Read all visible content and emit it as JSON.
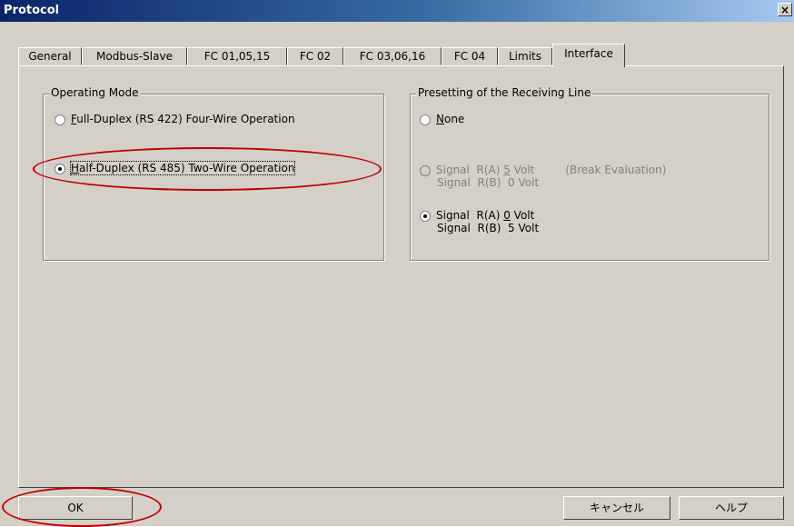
{
  "window": {
    "title": "Protocol",
    "close_glyph": "×"
  },
  "tabs": [
    {
      "label": "General"
    },
    {
      "label": "Modbus-Slave"
    },
    {
      "label": "FC 01,05,15"
    },
    {
      "label": "FC 02"
    },
    {
      "label": "FC 03,06,16"
    },
    {
      "label": "FC 04"
    },
    {
      "label": "Limits"
    },
    {
      "label": "Interface"
    }
  ],
  "active_tab": "Interface",
  "operating_mode": {
    "title": "Operating Mode",
    "full_duplex": {
      "mnemonic": "F",
      "rest": "ull-Duplex (RS 422) Four-Wire Operation",
      "selected": false
    },
    "half_duplex": {
      "mnemonic": "H",
      "rest": "alf-Duplex (RS 485) Two-Wire Operation",
      "selected": true
    }
  },
  "presetting": {
    "title": "Presetting of the Receiving Line",
    "none": {
      "mnemonic": "N",
      "rest": "one",
      "selected": false
    },
    "option1": {
      "line1_prefix": "Signal  R(A) ",
      "line1_mnemonic": "5",
      "line1_suffix": " Volt",
      "note": "(Break Evaluation)",
      "line2": "Signal  R(B)  0 Volt",
      "enabled": false,
      "selected": false
    },
    "option2": {
      "line1_prefix": "Signal  R(A) ",
      "line1_mnemonic": "0",
      "line1_suffix": " Volt",
      "line2": "Signal  R(B)  5 Volt",
      "enabled": true,
      "selected": true
    }
  },
  "buttons": {
    "ok": "OK",
    "cancel": "キャンセル",
    "help": "ヘルプ"
  },
  "annotation_color": "#c00000"
}
